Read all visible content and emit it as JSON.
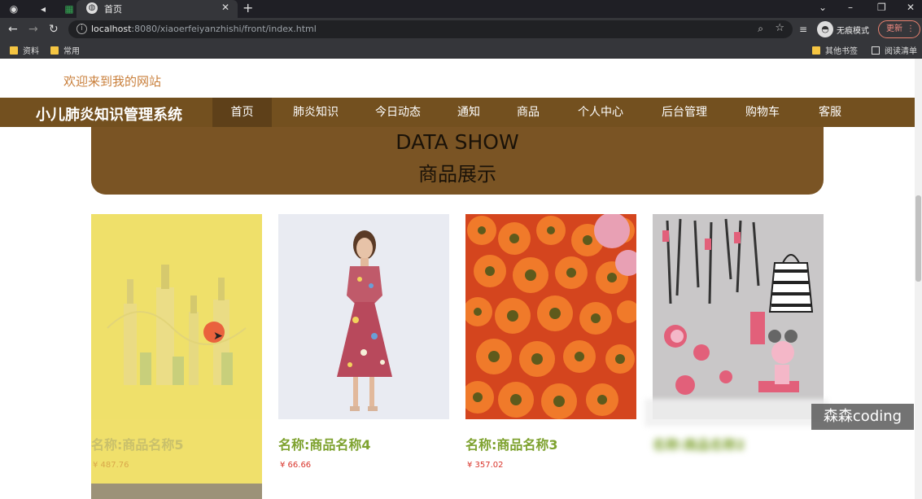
{
  "browser": {
    "tab_title": "首页",
    "url_host": "localhost",
    "url_rest": ":8080/xiaoerfeiyanzhishi/front/index.html",
    "incognito_label": "无痕模式",
    "update_label": "更新",
    "bookmarks": [
      "资料",
      "常用"
    ],
    "bookmarks_right": [
      "其他书签",
      "阅读清单"
    ]
  },
  "page": {
    "welcome": "欢迎来到我的网站",
    "site_title": "小儿肺炎知识管理系统",
    "nav": [
      "首页",
      "肺炎知识",
      "今日动态",
      "通知",
      "商品",
      "个人中心",
      "后台管理",
      "购物车",
      "客服"
    ],
    "nav_active": "首页",
    "banner_en": "DATA SHOW",
    "banner_cn": "商品展示",
    "products": [
      {
        "name": "名称:商品名称5",
        "price": "¥ 487.76",
        "image": "bottles-photo"
      },
      {
        "name": "名称:商品名称4",
        "price": "¥ 66.66",
        "image": "dress-photo"
      },
      {
        "name": "名称:商品名称3",
        "price": "¥ 357.02",
        "image": "flowers-photo"
      },
      {
        "name": "名称:商品名称2",
        "price": "",
        "image": "cosmetics-photo"
      }
    ]
  },
  "watermark": "森森coding",
  "colors": {
    "nav_bg": "#73501f",
    "banner_bg": "#7a5424",
    "product_name": "#7ea22f",
    "price": "#d9342b",
    "welcome": "#c97f3b"
  }
}
